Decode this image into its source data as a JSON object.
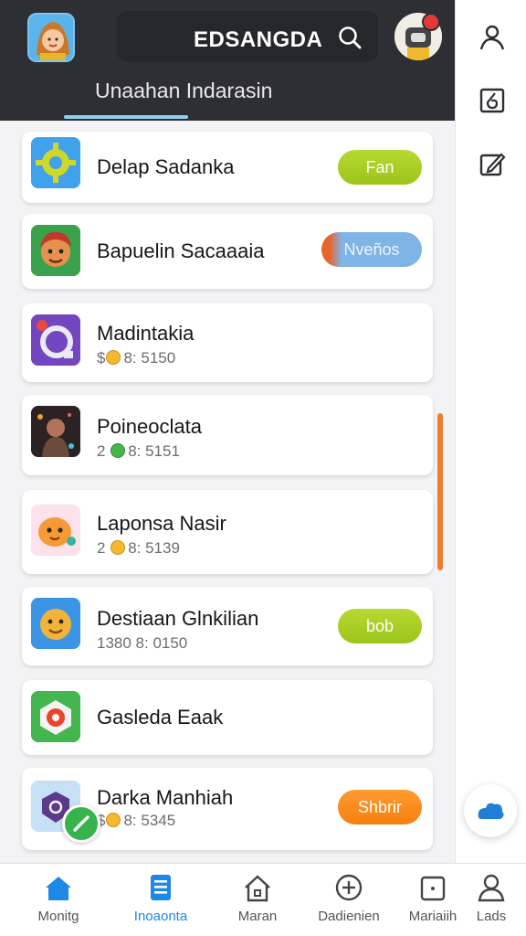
{
  "header": {
    "title": "EDSANGDA",
    "subtab": "Unaahan Indarasin"
  },
  "list": {
    "items": [
      {
        "title": "Delap Sadanka",
        "meta": "",
        "action": "Fan",
        "action_color": "#a8cf22"
      },
      {
        "title": "Bapuelin Sacaaaia",
        "meta": "",
        "action": "Nveños",
        "action_color": "#7fb4e6"
      },
      {
        "title": "Madintakia",
        "meta_prefix": "$",
        "meta": "8: 5150",
        "action": ""
      },
      {
        "title": "Poineoclata",
        "meta_prefix": "2",
        "meta": "8: 5151",
        "action": ""
      },
      {
        "title": "Laponsa Nasir",
        "meta_prefix": "2",
        "meta": "8: 5139",
        "action": ""
      },
      {
        "title": "Destiaan Glnkilian",
        "meta_prefix": "",
        "meta": "1380 8: 0150",
        "action": "bob",
        "action_color": "#a8cf22"
      },
      {
        "title": "Gasleda Eaak",
        "meta": "",
        "action": ""
      },
      {
        "title": "Darka Manhiah",
        "meta_prefix": "$",
        "meta": "8: 5345",
        "action": "Shbrir",
        "action_color": "#f57f10"
      }
    ]
  },
  "nav": {
    "items": [
      {
        "label": "Monitg",
        "icon": "home-icon",
        "active": false
      },
      {
        "label": "Inoaonta",
        "icon": "document-icon",
        "active": true
      },
      {
        "label": "Maran",
        "icon": "house-outline-icon",
        "active": false
      },
      {
        "label": "Dadienien",
        "icon": "plus-circle-icon",
        "active": false
      },
      {
        "label": "Mariaiih",
        "icon": "calendar-icon",
        "active": false
      },
      {
        "label": "Lads",
        "icon": "person-icon",
        "active": false
      }
    ]
  },
  "rail": {
    "icons": [
      "person-icon",
      "number-tag-icon",
      "edit-icon"
    ]
  },
  "colors": {
    "header_bg": "#2e2f35",
    "accent_blue": "#1e88e5",
    "lime": "#a8cf22",
    "orange": "#f57f10",
    "scroll_thumb": "#ef7d2a"
  }
}
